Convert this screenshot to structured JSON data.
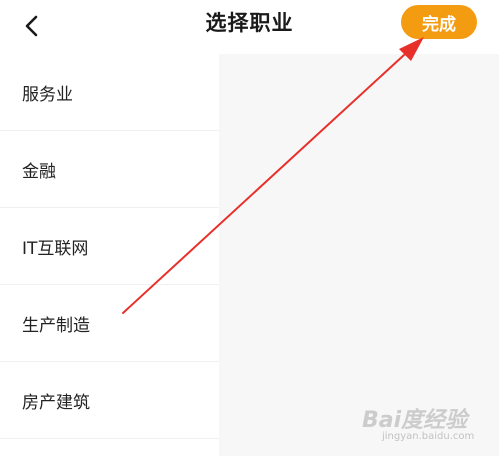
{
  "header": {
    "title": "选择职业",
    "done_label": "完成",
    "back_icon": "chevron-left-icon"
  },
  "colors": {
    "accent": "#f39c12",
    "arrow": "#e8302a",
    "panel_bg": "#f7f7f7"
  },
  "categories": [
    {
      "label": "服务业"
    },
    {
      "label": "金融"
    },
    {
      "label": "IT互联网"
    },
    {
      "label": "生产制造"
    },
    {
      "label": "房产建筑"
    }
  ],
  "watermark": {
    "text": "Bai度经验",
    "url_text": "jingyan.baidu.com"
  }
}
